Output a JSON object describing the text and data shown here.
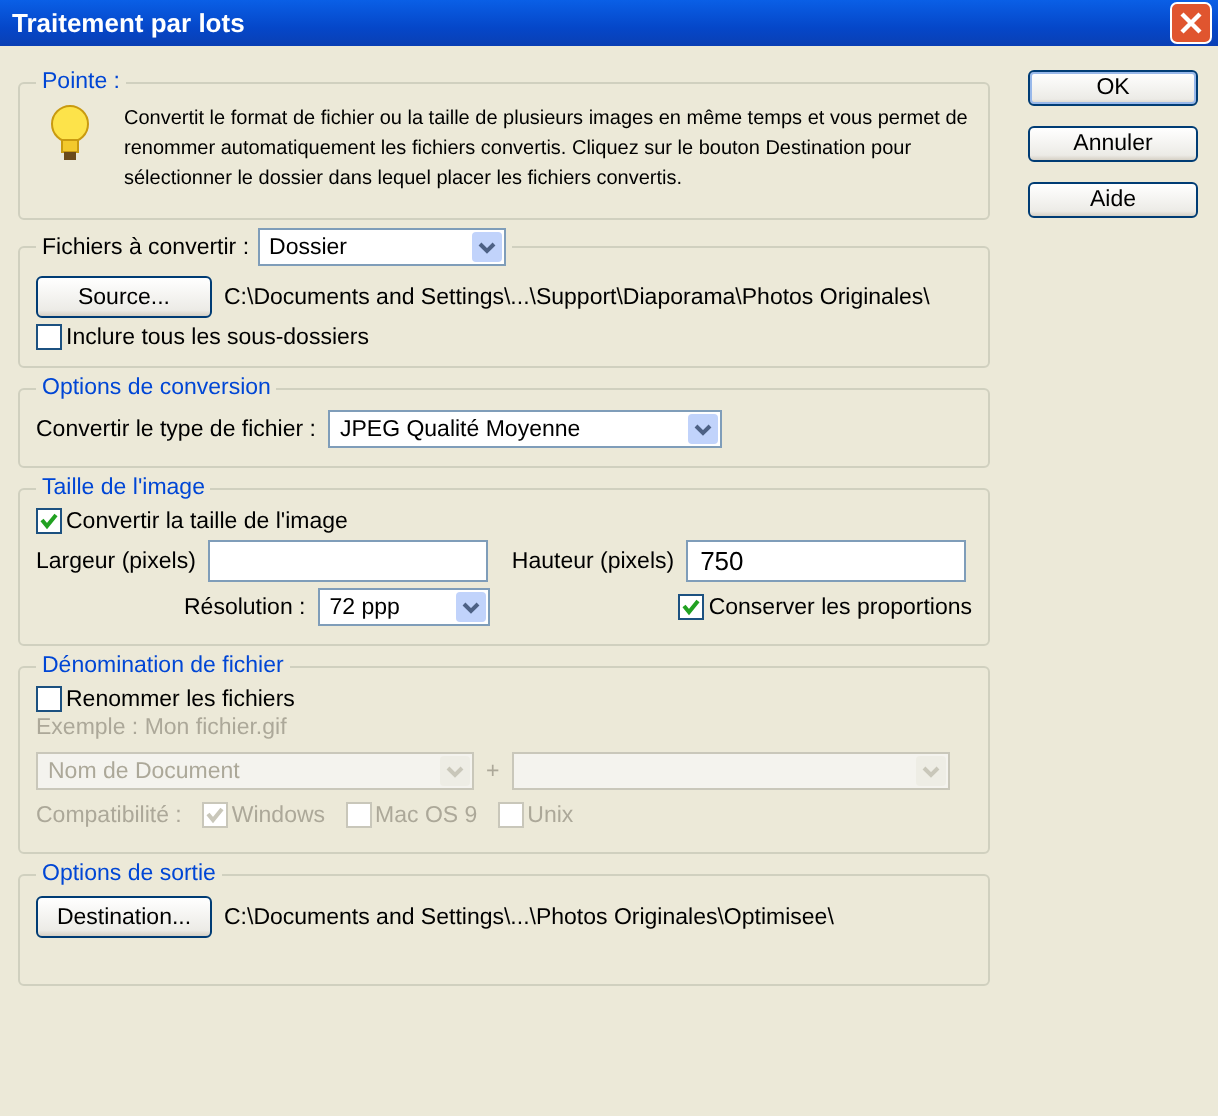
{
  "window": {
    "title": "Traitement par lots"
  },
  "tip": {
    "legend": "Pointe :",
    "text": "Convertit le format de fichier ou la taille de plusieurs images en même temps et vous permet de renommer automatiquement les fichiers convertis. Cliquez sur le bouton Destination pour sélectionner le dossier dans lequel placer les fichiers convertis."
  },
  "files": {
    "label": "Fichiers à convertir :",
    "source_type": "Dossier",
    "source_button": "Source...",
    "source_path": "C:\\Documents and Settings\\...\\Support\\Diaporama\\Photos Originales\\",
    "include_subfolders": {
      "label": "Inclure tous les sous-dossiers",
      "checked": false
    }
  },
  "conversion": {
    "legend": "Options de conversion",
    "label": "Convertir le type de fichier :",
    "value": "JPEG Qualité Moyenne"
  },
  "image_size": {
    "legend": "Taille de l'image",
    "resize": {
      "label": "Convertir la taille de l'image",
      "checked": true
    },
    "width": {
      "label": "Largeur (pixels)"
    },
    "height": {
      "label": "Hauteur (pixels)",
      "value": "750"
    },
    "resolution": {
      "label": "Résolution :",
      "value": "72 ppp"
    },
    "constrain": {
      "label": "Conserver les proportions",
      "checked": true
    }
  },
  "naming": {
    "legend": "Dénomination de fichier",
    "rename": {
      "label": "Renommer les fichiers",
      "checked": false
    },
    "disabled": true,
    "example": "Exemple : Mon fichier.gif",
    "name_part": "Nom de Document",
    "separator": "+",
    "compat_label": "Compatibilité :",
    "compat": [
      {
        "label": "Windows",
        "checked": true
      },
      {
        "label": "Mac OS 9",
        "checked": false
      },
      {
        "label": "Unix",
        "checked": false
      }
    ]
  },
  "output": {
    "legend": "Options de sortie",
    "button": "Destination...",
    "path": "C:\\Documents and Settings\\...\\Photos Originales\\Optimisee\\"
  },
  "buttons": [
    "OK",
    "Annuler",
    "Aide"
  ]
}
